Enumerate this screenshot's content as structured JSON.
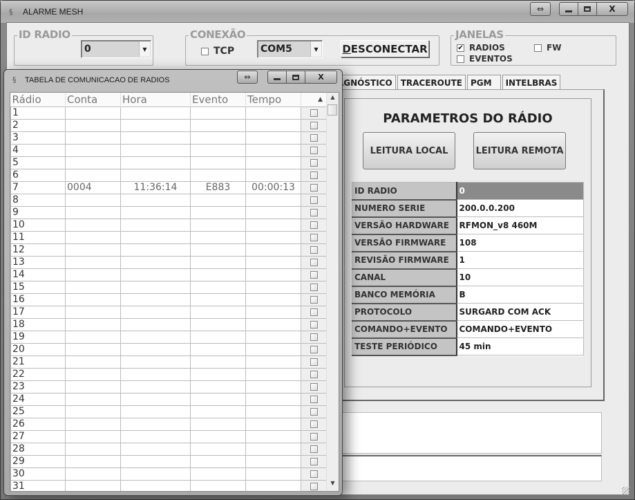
{
  "window": {
    "title": "ALARME MESH",
    "controls": {
      "resize": "⇔",
      "minimize": "▁",
      "maximize": "▫",
      "close": "X"
    }
  },
  "id_radio": {
    "label": "ID RADIO",
    "value": "0"
  },
  "conexao": {
    "label": "CONEXÃO",
    "tcp_label": "TCP",
    "tcp_checked": false,
    "port": "COM5",
    "disconnect_label": "DESCONECTAR",
    "disconnect_mnemonic": "D",
    "disconnect_rest": "ESCONECTAR"
  },
  "janelas": {
    "label": "JANELAS",
    "items": [
      {
        "label": "RADIOS",
        "checked": true
      },
      {
        "label": "EVENTOS",
        "checked": false
      },
      {
        "label": "FW",
        "checked": false
      }
    ]
  },
  "tabs": [
    {
      "label": "AGNÓSTICO"
    },
    {
      "label": "TRACEROUTE"
    },
    {
      "label": "PGM"
    },
    {
      "label": "INTELBRAS"
    }
  ],
  "params": {
    "title": "PARAMETROS DO RÁDIO",
    "local_button": "LEITURA LOCAL",
    "remote_button": "LEITURA REMOTA",
    "rows": [
      {
        "key": "ID RADIO",
        "value": "0"
      },
      {
        "key": "NUMERO SERIE",
        "value": "200.0.0.200"
      },
      {
        "key": "VERSÃO HARDWARE",
        "value": "RFMON_v8 460M"
      },
      {
        "key": "VERSÃO FIRMWARE",
        "value": "108"
      },
      {
        "key": "REVISÃO FIRMWARE",
        "value": "1"
      },
      {
        "key": "CANAL",
        "value": "10"
      },
      {
        "key": "BANCO MEMÓRIA",
        "value": "B"
      },
      {
        "key": "PROTOCOLO",
        "value": "SURGARD COM ACK"
      },
      {
        "key": "COMANDO+EVENTO",
        "value": "COMANDO+EVENTO"
      },
      {
        "key": "TESTE PERIÓDICO",
        "value": "45 min"
      }
    ]
  },
  "radio_table": {
    "title": "TABELA DE COMUNICACAO DE RADIOS",
    "columns": [
      "Rádio",
      "Conta",
      "Hora",
      "Evento",
      "Tempo"
    ],
    "rows": [
      {
        "radio": "1",
        "conta": "",
        "hora": "",
        "evento": "",
        "tempo": ""
      },
      {
        "radio": "2",
        "conta": "",
        "hora": "",
        "evento": "",
        "tempo": ""
      },
      {
        "radio": "3",
        "conta": "",
        "hora": "",
        "evento": "",
        "tempo": ""
      },
      {
        "radio": "4",
        "conta": "",
        "hora": "",
        "evento": "",
        "tempo": ""
      },
      {
        "radio": "5",
        "conta": "",
        "hora": "",
        "evento": "",
        "tempo": ""
      },
      {
        "radio": "6",
        "conta": "",
        "hora": "",
        "evento": "",
        "tempo": ""
      },
      {
        "radio": "7",
        "conta": "0004",
        "hora": "11:36:14",
        "evento": "E883",
        "tempo": "00:00:13"
      },
      {
        "radio": "8",
        "conta": "",
        "hora": "",
        "evento": "",
        "tempo": ""
      },
      {
        "radio": "9",
        "conta": "",
        "hora": "",
        "evento": "",
        "tempo": ""
      },
      {
        "radio": "10",
        "conta": "",
        "hora": "",
        "evento": "",
        "tempo": ""
      },
      {
        "radio": "11",
        "conta": "",
        "hora": "",
        "evento": "",
        "tempo": ""
      },
      {
        "radio": "12",
        "conta": "",
        "hora": "",
        "evento": "",
        "tempo": ""
      },
      {
        "radio": "13",
        "conta": "",
        "hora": "",
        "evento": "",
        "tempo": ""
      },
      {
        "radio": "14",
        "conta": "",
        "hora": "",
        "evento": "",
        "tempo": ""
      },
      {
        "radio": "15",
        "conta": "",
        "hora": "",
        "evento": "",
        "tempo": ""
      },
      {
        "radio": "16",
        "conta": "",
        "hora": "",
        "evento": "",
        "tempo": ""
      },
      {
        "radio": "17",
        "conta": "",
        "hora": "",
        "evento": "",
        "tempo": ""
      },
      {
        "radio": "18",
        "conta": "",
        "hora": "",
        "evento": "",
        "tempo": ""
      },
      {
        "radio": "19",
        "conta": "",
        "hora": "",
        "evento": "",
        "tempo": ""
      },
      {
        "radio": "20",
        "conta": "",
        "hora": "",
        "evento": "",
        "tempo": ""
      },
      {
        "radio": "21",
        "conta": "",
        "hora": "",
        "evento": "",
        "tempo": ""
      },
      {
        "radio": "22",
        "conta": "",
        "hora": "",
        "evento": "",
        "tempo": ""
      },
      {
        "radio": "23",
        "conta": "",
        "hora": "",
        "evento": "",
        "tempo": ""
      },
      {
        "radio": "24",
        "conta": "",
        "hora": "",
        "evento": "",
        "tempo": ""
      },
      {
        "radio": "25",
        "conta": "",
        "hora": "",
        "evento": "",
        "tempo": ""
      },
      {
        "radio": "26",
        "conta": "",
        "hora": "",
        "evento": "",
        "tempo": ""
      },
      {
        "radio": "27",
        "conta": "",
        "hora": "",
        "evento": "",
        "tempo": ""
      },
      {
        "radio": "28",
        "conta": "",
        "hora": "",
        "evento": "",
        "tempo": ""
      },
      {
        "radio": "29",
        "conta": "",
        "hora": "",
        "evento": "",
        "tempo": ""
      },
      {
        "radio": "30",
        "conta": "",
        "hora": "",
        "evento": "",
        "tempo": ""
      },
      {
        "radio": "31",
        "conta": "",
        "hora": "",
        "evento": "",
        "tempo": ""
      }
    ]
  }
}
